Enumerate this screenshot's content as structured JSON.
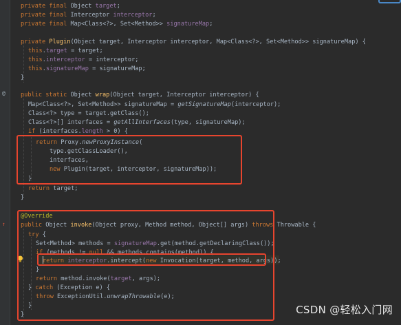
{
  "editor": {
    "lines": [
      [
        [
          "private final ",
          "kw"
        ],
        [
          "Object ",
          "p"
        ],
        [
          "target",
          "field"
        ],
        [
          ";",
          "p"
        ]
      ],
      [
        [
          "private final ",
          "kw"
        ],
        [
          "Interceptor ",
          "p"
        ],
        [
          "interceptor",
          "field"
        ],
        [
          ";",
          "p"
        ]
      ],
      [
        [
          "private final ",
          "kw"
        ],
        [
          "Map<Class<?>, Set<Method>> ",
          "p"
        ],
        [
          "signatureMap",
          "field"
        ],
        [
          ";",
          "p"
        ]
      ],
      [],
      [
        [
          "private ",
          "kw"
        ],
        [
          "Plugin",
          "fn"
        ],
        [
          "(Object target, Interceptor interceptor, Map<Class<?>, Set<Method>> signatureMap) {",
          "p"
        ]
      ],
      [
        [
          "this",
          "kw"
        ],
        [
          ".",
          "p"
        ],
        [
          "target",
          "field"
        ],
        [
          " = target;",
          "p"
        ]
      ],
      [
        [
          "this",
          "kw"
        ],
        [
          ".",
          "p"
        ],
        [
          "interceptor",
          "field"
        ],
        [
          " = interceptor;",
          "p"
        ]
      ],
      [
        [
          "this",
          "kw"
        ],
        [
          ".",
          "p"
        ],
        [
          "signatureMap",
          "field"
        ],
        [
          " = signatureMap;",
          "p"
        ]
      ],
      [
        [
          "}",
          "p"
        ]
      ],
      [],
      [
        [
          "public static ",
          "kw"
        ],
        [
          "Object ",
          "p"
        ],
        [
          "wrap",
          "fn"
        ],
        [
          "(Object target, Interceptor interceptor) {",
          "p"
        ]
      ],
      [
        [
          "Map<Class<?>, Set<Method>> signatureMap = ",
          "p"
        ],
        [
          "getSignatureMap",
          "it"
        ],
        [
          "(interceptor);",
          "p"
        ]
      ],
      [
        [
          "Class<?> type = target.getClass();",
          "p"
        ]
      ],
      [
        [
          "Class<?>[] interfaces = ",
          "p"
        ],
        [
          "getAllInterfaces",
          "it"
        ],
        [
          "(type, signatureMap);",
          "p"
        ]
      ],
      [
        [
          "if ",
          "kw"
        ],
        [
          "(interfaces.",
          "p"
        ],
        [
          "length",
          "field"
        ],
        [
          " > ",
          "p"
        ],
        [
          "0",
          "p"
        ],
        [
          ") {",
          "p"
        ]
      ],
      [
        [
          "return ",
          "kw"
        ],
        [
          "Proxy.",
          "p"
        ],
        [
          "newProxyInstance",
          "it"
        ],
        [
          "(",
          "p"
        ]
      ],
      [
        [
          "type.getClassLoader(),",
          "p"
        ]
      ],
      [
        [
          "interfaces,",
          "p"
        ]
      ],
      [
        [
          "new ",
          "kw"
        ],
        [
          "Plugin(target, interceptor, signatureMap));",
          "p"
        ]
      ],
      [
        [
          "}",
          "p"
        ]
      ],
      [
        [
          "return ",
          "kw"
        ],
        [
          "target;",
          "p"
        ]
      ],
      [
        [
          "}",
          "p"
        ]
      ],
      [],
      [
        [
          "@Override",
          "ann"
        ]
      ],
      [
        [
          "public ",
          "kw"
        ],
        [
          "Object ",
          "p"
        ],
        [
          "invoke",
          "fn"
        ],
        [
          "(Object proxy, Method method, Object[] args) ",
          "p"
        ],
        [
          "throws ",
          "kw"
        ],
        [
          "Throwable {",
          "p"
        ]
      ],
      [
        [
          "try ",
          "kw"
        ],
        [
          "{",
          "p"
        ]
      ],
      [
        [
          "Set<Method> methods = ",
          "p"
        ],
        [
          "signatureMap",
          "field"
        ],
        [
          ".get(method.getDeclaringClass());",
          "p"
        ]
      ],
      [
        [
          "if ",
          "kw"
        ],
        [
          "(methods != ",
          "p"
        ],
        [
          "null ",
          "kw"
        ],
        [
          "&& methods.contains(method)) {",
          "p"
        ]
      ],
      [
        [
          "return ",
          "kw"
        ],
        [
          "interceptor",
          "field"
        ],
        [
          ".intercept(",
          "p"
        ],
        [
          "new ",
          "kw"
        ],
        [
          "Invocation(target, method, args));",
          "p"
        ]
      ],
      [
        [
          "}",
          "p"
        ]
      ],
      [
        [
          "return ",
          "kw"
        ],
        [
          "method.invoke(",
          "p"
        ],
        [
          "target",
          "field"
        ],
        [
          ", args);",
          "p"
        ]
      ],
      [
        [
          "} ",
          "p"
        ],
        [
          "catch ",
          "kw"
        ],
        [
          "(Exception e) {",
          "p"
        ]
      ],
      [
        [
          "throw ",
          "kw"
        ],
        [
          "ExceptionUtil.",
          "p"
        ],
        [
          "unwrapThrowable",
          "it"
        ],
        [
          "(e);",
          "p"
        ]
      ],
      [
        [
          "}",
          "p"
        ]
      ],
      [
        [
          "}",
          "p"
        ]
      ]
    ]
  },
  "colors": {
    "background": "#2b2b2b",
    "highlight_box": "#e8452e",
    "keyword": "#cc7832",
    "field": "#9876aa",
    "method_decl": "#ffc66d",
    "annotation": "#bbb529",
    "text": "#a9b7c6"
  },
  "gutter": {
    "override_marker": "@",
    "implements_marker": "↑",
    "intention_icon": "lightbulb-icon"
  },
  "watermark": "CSDN @轻松入门网"
}
